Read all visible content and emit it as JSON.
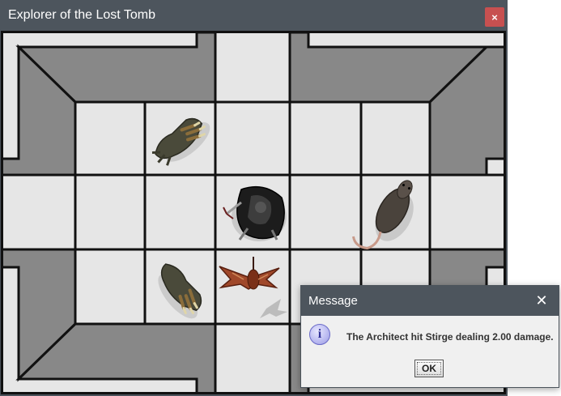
{
  "window": {
    "title": "Explorer of the Lost Tomb",
    "close_glyph": "×"
  },
  "board": {
    "wall_color": "#8a8a8a",
    "floor_color": "#e6e6e6",
    "grid_color": "#111111",
    "tiles": [
      {
        "id": "severed-hand-top",
        "icon": "zombie-hand-icon",
        "label": "Crawling hand"
      },
      {
        "id": "severed-hand-bottom",
        "icon": "zombie-hand-icon",
        "label": "Crawling hand"
      },
      {
        "id": "architect",
        "icon": "armored-warrior-icon",
        "label": "The Architect"
      },
      {
        "id": "rat",
        "icon": "giant-rat-icon",
        "label": "Giant rat"
      },
      {
        "id": "stirge",
        "icon": "stirge-icon",
        "label": "Stirge"
      }
    ]
  },
  "dialog": {
    "title": "Message",
    "message": "The Architect hit Stirge dealing 2.00 damage.",
    "ok_label": "OK",
    "info_glyph": "i",
    "close_glyph": "✕"
  }
}
